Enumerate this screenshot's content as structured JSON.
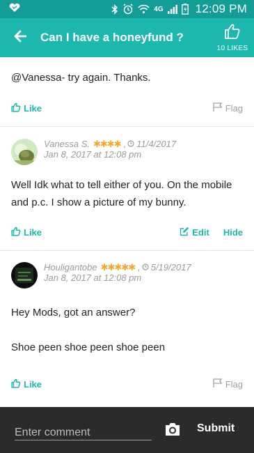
{
  "status_bar": {
    "network": "4G",
    "time": "12:09 PM",
    "brand_color": "#129e96"
  },
  "header": {
    "title": "Can I have a honeyfund ?",
    "likes_label": "10 LIKES",
    "brand_color": "#1cb8ad"
  },
  "posts": [
    {
      "body": "@Vanessa- try again. Thanks.",
      "like_label": "Like",
      "flag_label": "Flag"
    },
    {
      "author": "Vanessa S.",
      "stars": "✱✱✱✱",
      "member_since": "11/4/2017",
      "posted": "Jan 8, 2017 at 12:08 pm",
      "body": "Well Idk what to tell either of you. On the mobile and p.c. I show a picture of my bunny.",
      "like_label": "Like",
      "edit_label": "Edit",
      "hide_label": "Hide"
    },
    {
      "author": "Houligantobe",
      "stars": "✱✱✱✱✱",
      "member_since": "5/19/2017",
      "posted": "Jan 8, 2017 at 12:08 pm",
      "body_1": "Hey Mods, got an answer?",
      "body_2": "Shoe peen shoe peen shoe peen",
      "like_label": "Like",
      "flag_label": "Flag"
    }
  ],
  "composer": {
    "placeholder": "Enter comment",
    "submit_label": "Submit"
  },
  "icons": [
    "iheart-icon",
    "bluetooth-icon",
    "alarm-icon",
    "wifi-icon",
    "signal-icon",
    "battery-icon",
    "back-arrow-icon",
    "thumbs-up-icon",
    "flag-icon",
    "edit-icon",
    "calendar-icon",
    "camera-icon"
  ]
}
